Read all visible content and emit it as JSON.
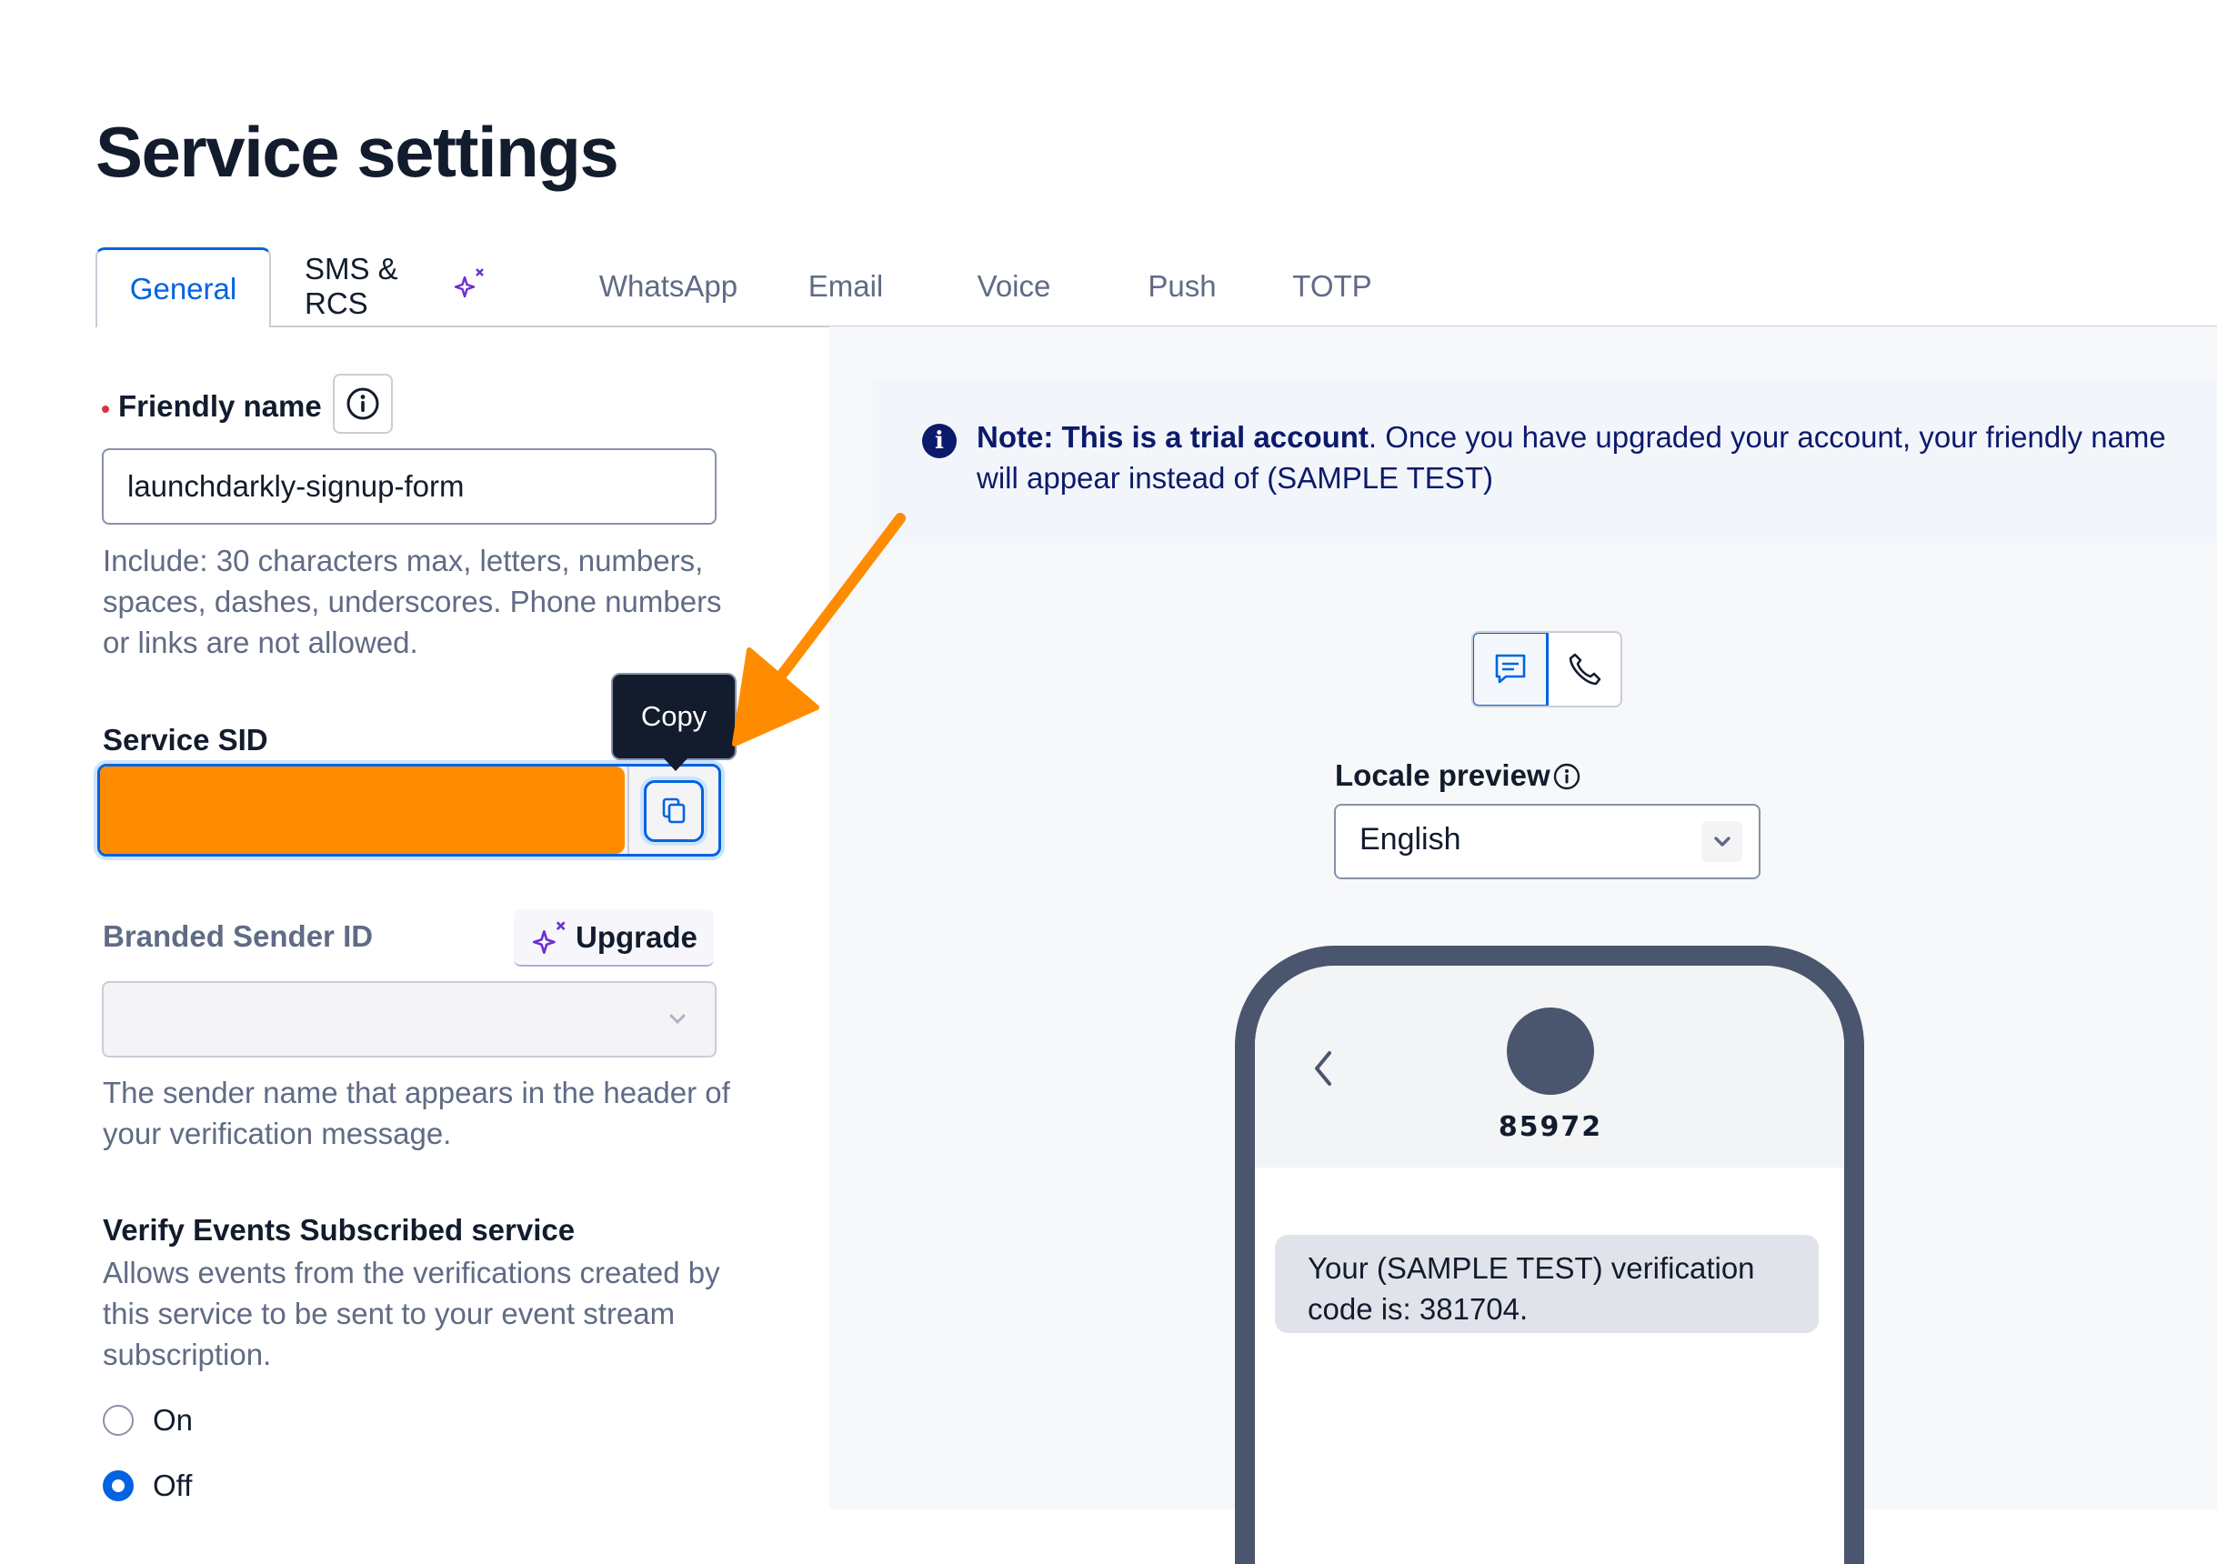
{
  "page": {
    "title": "Service settings"
  },
  "tabs": [
    {
      "label": "General",
      "active": true
    },
    {
      "label": "SMS & RCS",
      "badge_icon": "sparkle-icon"
    },
    {
      "label": "WhatsApp"
    },
    {
      "label": "Email"
    },
    {
      "label": "Voice"
    },
    {
      "label": "Push"
    },
    {
      "label": "TOTP"
    }
  ],
  "friendly_name": {
    "label": "Friendly name",
    "required": true,
    "value": "launchdarkly-signup-form",
    "help": "Include: 30 characters max, letters, numbers, spaces, dashes, underscores. Phone numbers or links are not allowed."
  },
  "service_sid": {
    "label": "Service SID",
    "value": "",
    "redacted_color": "#ff8c00",
    "copy_tooltip": "Copy"
  },
  "branded_sender": {
    "label": "Branded Sender ID",
    "upgrade_label": "Upgrade",
    "selected": "",
    "help": "The sender name that appears in the header of your verification message."
  },
  "verify_events": {
    "label": "Verify Events Subscribed service",
    "description": "Allows events from the verifications created by this service to be sent to your event stream subscription.",
    "options": [
      {
        "label": "On",
        "selected": false
      },
      {
        "label": "Off",
        "selected": true
      }
    ]
  },
  "notice": {
    "bold": "Note: This is a trial account",
    "text": ". Once you have upgraded your account, your friendly name will appear instead of (SAMPLE TEST)"
  },
  "preview": {
    "channel_toggle": [
      {
        "icon": "message-icon",
        "selected": true
      },
      {
        "icon": "phone-icon",
        "selected": false
      }
    ],
    "locale_label": "Locale preview",
    "locale_value": "English",
    "contact_number": "85972",
    "message": "Your (SAMPLE TEST) verification code is: 381704."
  },
  "colors": {
    "accent": "#0263e0",
    "annotation_arrow": "#ff8c00",
    "notice_text": "#0c1a6b",
    "phone_frame": "#4a566e"
  }
}
